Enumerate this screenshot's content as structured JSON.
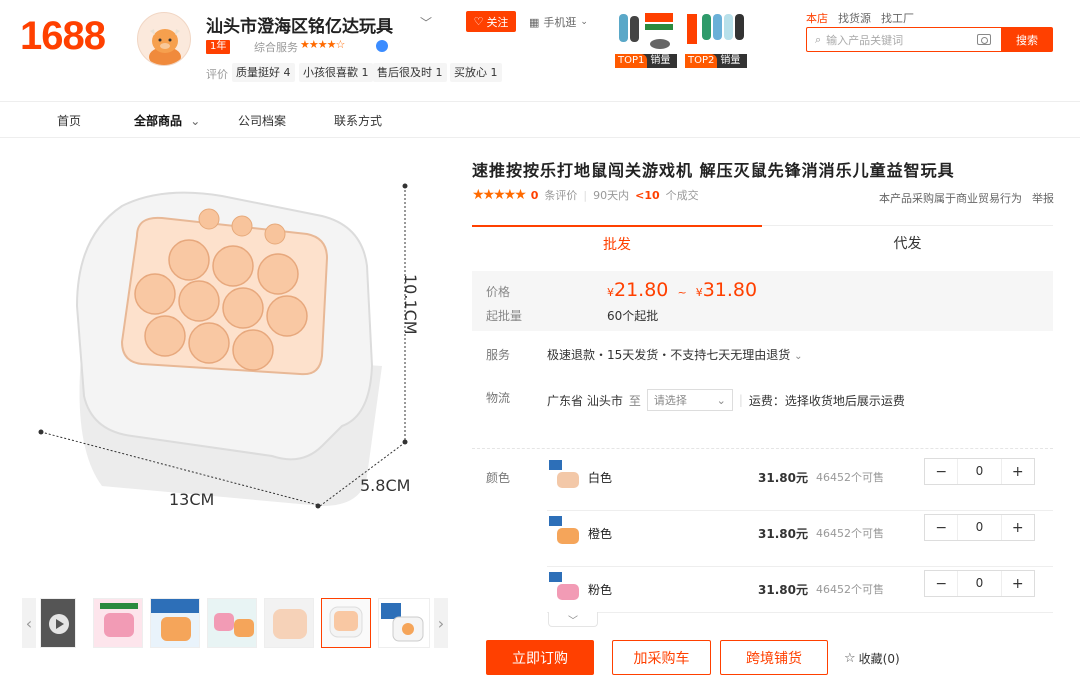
{
  "header": {
    "logo": "1688",
    "shop_name": "汕头市澄海区铭亿达玩具",
    "follow_label": "关注",
    "mobile_label": "手机逛",
    "year_badge": "1年",
    "service_label": "综合服务",
    "service_stars": "★★★★☆",
    "eval_label": "评价",
    "eval_tags": [
      "质量挺好 4",
      "小孩很喜歡 1",
      "售后很及时 1",
      "买放心 1"
    ],
    "top_badges": [
      {
        "rank": "TOP1",
        "text": "销量"
      },
      {
        "rank": "TOP2",
        "text": "销量"
      }
    ],
    "search_tabs": [
      "本店",
      "找货源",
      "找工厂"
    ],
    "search_placeholder": "输入产品关键词",
    "search_button": "搜索"
  },
  "nav": {
    "items": [
      "首页",
      "全部商品",
      "公司档案",
      "联系方式"
    ]
  },
  "gallery": {
    "dim_height": "10.1CM",
    "dim_width": "13CM",
    "dim_depth": "5.8CM"
  },
  "product": {
    "title": "速推按按乐打地鼠闯关游戏机 解压灭鼠先锋消消乐儿童益智玩具",
    "stars": "★★★★★",
    "review_count": "0",
    "review_label": "条评价",
    "period_label": "90天内",
    "deal_count": "<10",
    "deal_label": "个成交",
    "trade_note": "本产品采购属于商业贸易行为",
    "report": "举报",
    "tabs": [
      "批发",
      "代发"
    ],
    "price_label": "价格",
    "currency": "¥",
    "price_low": "21.80",
    "tilde": "~",
    "price_high": "31.80",
    "moq_label": "起批量",
    "moq_value": "60个起批",
    "service_row_label": "服务",
    "service_value": "极速退款・15天发货・不支持七天无理由退货",
    "logistics_label": "物流",
    "origin": "广东省 汕头市",
    "to_label": "至",
    "dest_placeholder": "请选择",
    "shipping_note": "运费：选择收货地后展示运费",
    "color_label": "颜色",
    "skus": [
      {
        "name": "白色",
        "price": "31.80元",
        "stock": "46452个可售",
        "qty": "0",
        "color": "#f3c8a8"
      },
      {
        "name": "橙色",
        "price": "31.80元",
        "stock": "46452个可售",
        "qty": "0",
        "color": "#f5a55a"
      },
      {
        "name": "粉色",
        "price": "31.80元",
        "stock": "46452个可售",
        "qty": "0",
        "color": "#f29bb5"
      }
    ],
    "buttons": {
      "buy": "立即订购",
      "cart": "加采购车",
      "cross": "跨境铺货",
      "favorite": "收藏(0)"
    }
  },
  "colors": {
    "brand": "#ff4000",
    "star": "#ff6a00"
  }
}
